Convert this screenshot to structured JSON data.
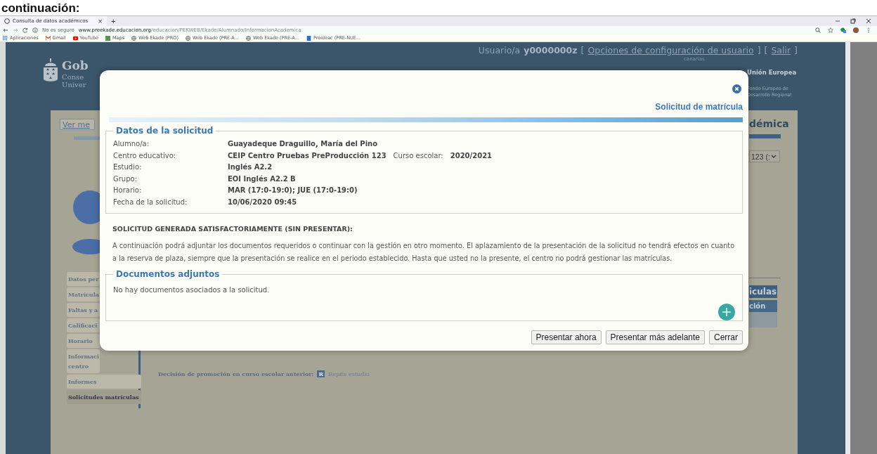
{
  "caption_fragment": "continuación:",
  "browser": {
    "tabs": [
      {
        "title": "Consulta de datos académicos",
        "close": "×",
        "selected": true
      }
    ],
    "new_tab": "+",
    "security": "No es seguro",
    "url_host": "www.preekade.educacion.org",
    "url_path": "/educacion/PEKWEB/Ekade/Alumnado/InformacionAcademica",
    "bookmarks": [
      {
        "label": "Aplicaciones",
        "kind": "apps"
      },
      {
        "label": "Gmail",
        "kind": "mail"
      },
      {
        "label": "YouTube",
        "kind": "video"
      },
      {
        "label": "Maps",
        "kind": "map"
      },
      {
        "label": "Web Ekade (PRO)",
        "kind": "globe"
      },
      {
        "label": "Web Ekade (PRE-A...",
        "kind": "globe"
      },
      {
        "label": "Web Ekade (PRE-A...",
        "kind": "globe"
      },
      {
        "label": "Proideac (PRE-NUE...",
        "kind": "file"
      }
    ]
  },
  "page": {
    "user_bar": [
      {
        "text": "Usuario/a",
        "kind": "plain"
      },
      {
        "text": "y0000000z",
        "kind": "bold"
      },
      {
        "text": "[",
        "kind": "plain"
      },
      {
        "text": "Opciones de configuración de usuario",
        "kind": "link"
      },
      {
        "text": "]",
        "kind": "plain"
      },
      {
        "text": "[",
        "kind": "plain"
      },
      {
        "text": "Salir",
        "kind": "link"
      },
      {
        "text": "]",
        "kind": "plain"
      }
    ],
    "logo_text": [
      "Gob",
      "Conse",
      "Univer"
    ],
    "partner": {
      "region": "canarias",
      "eu": "Unión Europea",
      "fund": [
        "Fondo Europeo de",
        "Desarrollo Regional"
      ]
    },
    "more_link": "Ver me",
    "sidebar": [
      {
        "lines": [
          "Datos per"
        ],
        "selected": false
      },
      {
        "lines": [
          "Matrícula"
        ],
        "selected": false
      },
      {
        "lines": [
          "Faltas y a"
        ],
        "selected": false
      },
      {
        "lines": [
          "Calificaci"
        ],
        "selected": false
      },
      {
        "lines": [
          "Horario"
        ],
        "selected": false
      },
      {
        "lines": [
          "Informaci",
          "centro"
        ],
        "selected": false
      },
      {
        "lines": [
          "Informes"
        ],
        "selected": false
      },
      {
        "lines": [
          "Solicitudes matrículas"
        ],
        "selected": true
      }
    ],
    "promotion": {
      "label": "Decisión de promoción en curso escolar anterior:",
      "badge": "R",
      "value": "Repite estudio"
    },
    "right": {
      "heading": "démica",
      "select": "123 (:",
      "tabs": [
        "iculas",
        "ción"
      ]
    }
  },
  "modal": {
    "title": "Solicitud de matrícula",
    "details": {
      "legend": "Datos de la solicitud",
      "rows": [
        {
          "label": "Alumno/a:",
          "value": "Guayadeque Draguillo, María del Pino"
        },
        {
          "label": "Centro educativo:",
          "value": "CEIP Centro Pruebas PreProducción 123",
          "extra_label": "Curso escolar:",
          "extra_value": "2020/2021"
        },
        {
          "label": "Estudio:",
          "value": "Inglés A2.2"
        },
        {
          "label": "Grupo:",
          "value": "EOI Inglés A2.2 B"
        },
        {
          "label": "Horario:",
          "value": "MAR (17:0-19:0); JUE (17:0-19:0)"
        },
        {
          "label": "Fecha de la solicitud:",
          "value": "10/06/2020 09:45"
        }
      ]
    },
    "status": "SOLICITUD GENERADA SATISFACTORIAMENTE (SIN PRESENTAR):",
    "message": "A continuación podrá adjuntar los documentos requeridos o continuar con la gestión en otro momento. El aplazamiento de la presentación de la solicitud no tendrá efectos en cuanto a la reserva de plaza, siempre que la presentación se realice en el periodo establecido. Hasta que usted no la presente, el centro no podrá gestionar las matrículas.",
    "documents": {
      "legend": "Documentos adjuntos",
      "empty": "No hay documentos asociados a la solicitud."
    },
    "buttons": [
      "Presentar ahora",
      "Presentar más adelante",
      "Cerrar"
    ]
  }
}
